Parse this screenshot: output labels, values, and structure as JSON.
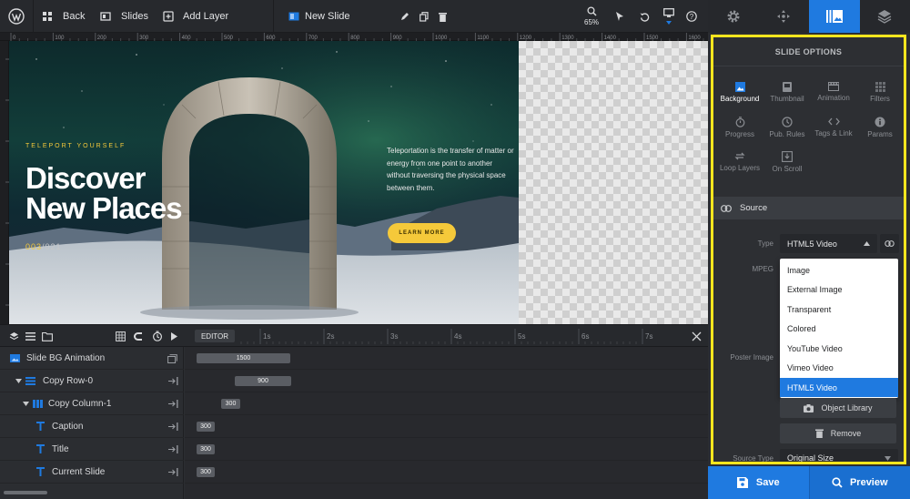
{
  "toolbar": {
    "back_label": "Back",
    "slides_label": "Slides",
    "add_layer_label": "Add Layer",
    "slide_name": "New Slide",
    "zoom": "65%"
  },
  "ruler": {
    "ticks": [
      "0",
      "100",
      "200",
      "300",
      "400",
      "500",
      "600",
      "700",
      "800",
      "900",
      "1000",
      "1100",
      "1200",
      "1300",
      "1400",
      "1500",
      "1600"
    ]
  },
  "slide": {
    "eyebrow": "TELEPORT YOURSELF",
    "title_line1": "Discover",
    "title_line2": "New Places",
    "counter_current": "003",
    "counter_total": "/021",
    "description": "Teleportation is the transfer of matter or energy from one point to another without traversing the physical space between them.",
    "button": "LEARN MORE"
  },
  "timeline": {
    "editor_label": "EDITOR",
    "marks": [
      "1s",
      "2s",
      "3s",
      "4s",
      "5s",
      "6s",
      "7s"
    ],
    "layers": [
      {
        "name": "Slide BG Animation",
        "duration": "1500"
      },
      {
        "name": "Copy Row-0",
        "duration": "900"
      },
      {
        "name": "Copy Column-1",
        "duration": "300"
      },
      {
        "name": "Caption",
        "duration": "300"
      },
      {
        "name": "Title",
        "duration": "300"
      },
      {
        "name": "Current Slide",
        "duration": "300"
      }
    ]
  },
  "panel": {
    "title": "SLIDE OPTIONS",
    "options": [
      {
        "label": "Background",
        "icon": "image-icon"
      },
      {
        "label": "Thumbnail",
        "icon": "thumbnail-icon"
      },
      {
        "label": "Animation",
        "icon": "film-icon"
      },
      {
        "label": "Filters",
        "icon": "filter-grid-icon"
      },
      {
        "label": "Progress",
        "icon": "stopwatch-icon"
      },
      {
        "label": "Pub. Rules",
        "icon": "clock-icon"
      },
      {
        "label": "Tags & Link",
        "icon": "code-icon"
      },
      {
        "label": "Params",
        "icon": "info-icon"
      },
      {
        "label": "Loop Layers",
        "icon": "loop-icon"
      },
      {
        "label": "On Scroll",
        "icon": "download-icon"
      }
    ],
    "section_title": "Source",
    "type_label": "Type",
    "type_value": "HTML5 Video",
    "mpeg_label": "MPEG",
    "poster_label": "Poster Image",
    "source_type_label": "Source Type",
    "source_type_value": "Original Size",
    "dropdown_options": [
      "Image",
      "External Image",
      "Transparent",
      "Colored",
      "YouTube Video",
      "Vimeo Video",
      "HTML5 Video"
    ],
    "object_library_label": "Object Library",
    "remove_label": "Remove"
  },
  "footer": {
    "save_label": "Save",
    "preview_label": "Preview"
  },
  "colors": {
    "accent_blue": "#1f7ae0",
    "highlight_yellow": "#ffe61e",
    "slide_gold": "#f5c93a"
  }
}
